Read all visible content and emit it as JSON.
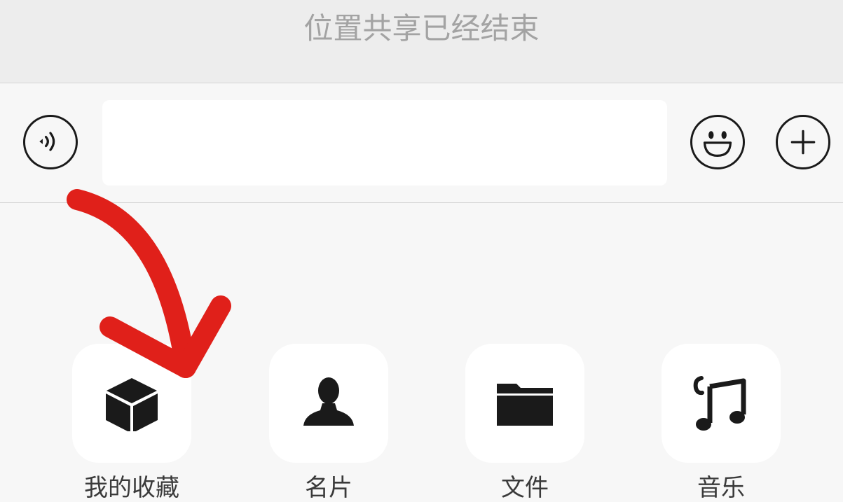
{
  "system_message": "位置共享已经结束",
  "input_bar": {
    "voice_icon": "voice-input-icon",
    "message_value": "",
    "emoji_icon": "smiley-face-icon",
    "plus_icon": "plus-icon"
  },
  "panel": {
    "items": [
      {
        "label": "我的收藏",
        "icon": "cube-icon"
      },
      {
        "label": "名片",
        "icon": "person-icon"
      },
      {
        "label": "文件",
        "icon": "folder-icon"
      },
      {
        "label": "音乐",
        "icon": "music-note-icon"
      }
    ]
  },
  "annotation": {
    "arrow_color": "#e0201a"
  }
}
